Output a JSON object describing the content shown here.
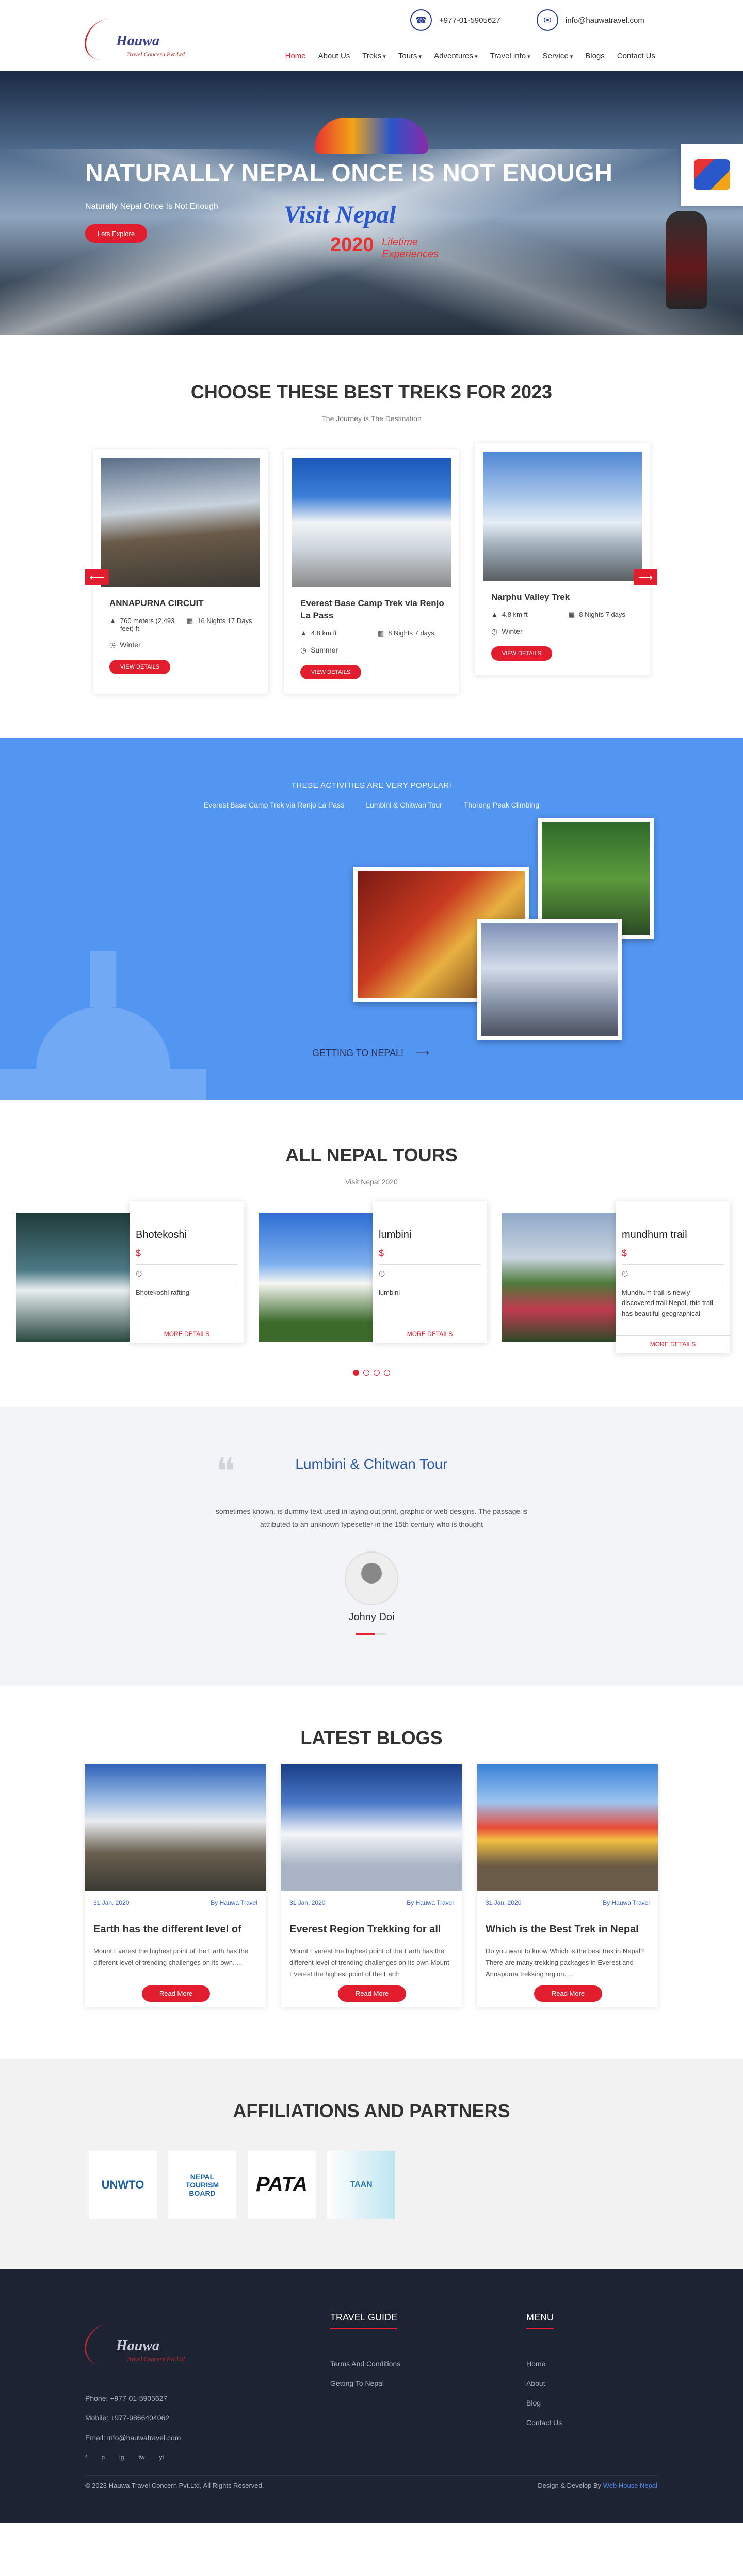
{
  "header": {
    "logo_text": "Hauwa",
    "logo_sub": "Travel Concern Pvt.Ltd",
    "phone": "+977-01-5905627",
    "email": "info@hauwatravel.com",
    "nav": [
      "Home",
      "About Us",
      "Treks",
      "Tours",
      "Adventures",
      "Travel info",
      "Service",
      "Blogs",
      "Contact Us"
    ]
  },
  "hero": {
    "title": "NATURALLY NEPAL ONCE IS NOT ENOUGH",
    "subtitle": "Naturally Nepal Once Is Not Enough",
    "button": "Lets Explore",
    "visit_word1": "Visit",
    "visit_word2": "Nepal",
    "year": "2020",
    "tagline": "Lifetime Experiences",
    "badge_text": "VISIT NEPAL 2020"
  },
  "treks": {
    "title": "CHOOSE THESE BEST TREKS FOR 2023",
    "subtitle": "The Journey is The Destination",
    "items": [
      {
        "name": "ANNAPURNA CIRCUIT",
        "altitude": "760 meters (2,493 feet) ft",
        "duration": "16 Nights 17 Days",
        "season": "Winter",
        "button": "VIEW DETAILS"
      },
      {
        "name": "Everest Base Camp Trek via Renjo La Pass",
        "altitude": "4.8 km ft",
        "duration": "8 Nights 7 days",
        "season": "Summer",
        "button": "VIEW DETAILS"
      },
      {
        "name": "Narphu Valley Trek",
        "altitude": "4.8 km ft",
        "duration": "8 Nights 7 days",
        "season": "Winter",
        "button": "VIEW DETAILS"
      }
    ]
  },
  "activities": {
    "title": "THESE ACTIVITIES ARE VERY POPULAR!",
    "links": [
      "Everest Base Camp Trek via Renjo La Pass",
      "Lumbini & Chitwan Tour",
      "Thorong Peak Climbing"
    ],
    "cta": "GETTING TO NEPAL!"
  },
  "tours": {
    "title": "ALL NEPAL TOURS",
    "subtitle": "Visit Nepal 2020",
    "items": [
      {
        "name": "Bhotekoshi",
        "price": "$",
        "desc": "Bhotekoshi rafting",
        "button": "MORE DETAILS"
      },
      {
        "name": "lumbini",
        "price": "$",
        "desc": "lumbini",
        "button": "MORE DETAILS"
      },
      {
        "name": "mundhum trail",
        "price": "$",
        "desc": "Mundhum trail is newly discovered trail Nepal, this trail has beautiful geographical",
        "button": "MORE DETAILS"
      }
    ]
  },
  "testimonial": {
    "title": "Lumbini & Chitwan Tour",
    "text_line1": "sometimes known, is dummy text used in laying out print, graphic or web designs. The passage is",
    "text_line2": "attributed to an unknown typesetter in the 15th century who is thought",
    "name": "Johny Doi"
  },
  "blogs": {
    "title": "LATEST BLOGS",
    "items": [
      {
        "date": "31 Jan, 2020",
        "author": "By Hauwa Travel",
        "title": "Earth has the different level of",
        "body": "Mount Everest the highest point of the Earth has the different level of trending challenges on its own. ...",
        "button": "Read More"
      },
      {
        "date": "31 Jan, 2020",
        "author": "By Hauwa Travel",
        "title": "Everest Region Trekking for all",
        "body": "Mount Everest the highest point of the Earth has the different level of trending challenges on its own Mount Everest the highest point of the Earth",
        "button": "Read More"
      },
      {
        "date": "31 Jan, 2020",
        "author": "By Hauwa Travel",
        "title": "Which is the Best Trek in Nepal",
        "body": "Do you want to know Which is the best trek in Nepal? There are many trekking packages in Everest and Annapurna trekking region. ...",
        "button": "Read More"
      }
    ]
  },
  "partners": {
    "title": "AFFILIATIONS AND PARTNERS",
    "logos": [
      "UNWTO",
      "NEPAL TOURISM BOARD",
      "PATA",
      "TAAN"
    ]
  },
  "footer": {
    "phone": "Phone: +977-01-5905627",
    "mobile": "Mobile: +977-9866404062",
    "email": "Email: info@hauwatravel.com",
    "social": [
      "f",
      "p",
      "ig",
      "tw",
      "yt"
    ],
    "guide_title": "TRAVEL GUIDE",
    "guide_links": [
      "Terms And Conditions",
      "Getting To Nepal"
    ],
    "menu_title": "MENU",
    "menu_links": [
      "Home",
      "About",
      "Blog",
      "Contact Us"
    ],
    "copyright": "© 2023 Hauwa Travel Concern Pvt.Ltd, All Rights Reserved.",
    "design_prefix": "Design & Develop By",
    "design_by": "Web House Nepal"
  }
}
